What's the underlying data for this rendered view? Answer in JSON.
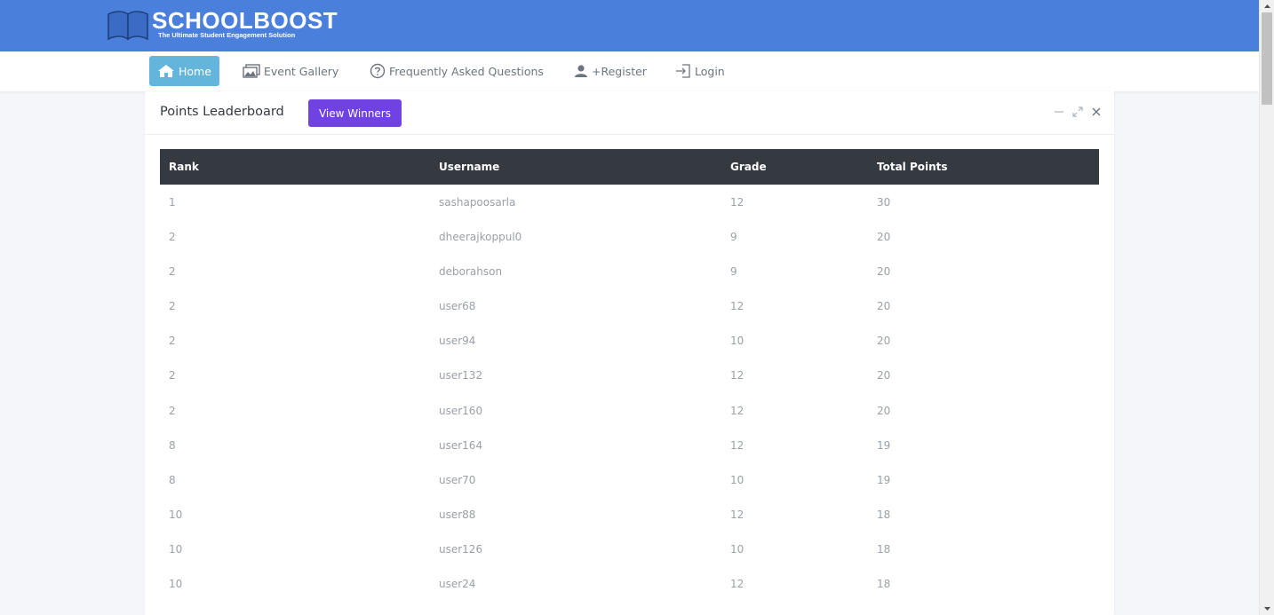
{
  "header": {
    "brand_title": "SCHOOLBOOST",
    "brand_tagline": "The Ultimate Student Engagement Solution",
    "background_color": "#4a7fdc"
  },
  "nav": {
    "items": [
      {
        "label": "Home",
        "icon": "home-icon",
        "active": true
      },
      {
        "label": "Event Gallery",
        "icon": "gallery-icon",
        "active": false
      },
      {
        "label": "Frequently Asked Questions",
        "icon": "question-circle-icon",
        "active": false
      },
      {
        "label": "+Register",
        "icon": "user-add-icon",
        "active": false
      },
      {
        "label": "Login",
        "icon": "sign-in-icon",
        "active": false
      }
    ],
    "active_color": "#64b5dc"
  },
  "card": {
    "title": "Points Leaderboard",
    "winners_button": "View Winners",
    "button_color": "#6f42e1",
    "tools": [
      "minimize-icon",
      "expand-icon",
      "close-icon"
    ]
  },
  "table": {
    "headers": [
      "Rank",
      "Username",
      "Grade",
      "Total Points"
    ],
    "rows": [
      {
        "rank": "1",
        "username": "sashapoosarla",
        "grade": "12",
        "points": "30"
      },
      {
        "rank": "2",
        "username": "dheerajkoppul0",
        "grade": "9",
        "points": "20"
      },
      {
        "rank": "2",
        "username": "deborahson",
        "grade": "9",
        "points": "20"
      },
      {
        "rank": "2",
        "username": "user68",
        "grade": "12",
        "points": "20"
      },
      {
        "rank": "2",
        "username": "user94",
        "grade": "10",
        "points": "20"
      },
      {
        "rank": "2",
        "username": "user132",
        "grade": "12",
        "points": "20"
      },
      {
        "rank": "2",
        "username": "user160",
        "grade": "12",
        "points": "20"
      },
      {
        "rank": "8",
        "username": "user164",
        "grade": "12",
        "points": "19"
      },
      {
        "rank": "8",
        "username": "user70",
        "grade": "10",
        "points": "19"
      },
      {
        "rank": "10",
        "username": "user88",
        "grade": "12",
        "points": "18"
      },
      {
        "rank": "10",
        "username": "user126",
        "grade": "10",
        "points": "18"
      },
      {
        "rank": "10",
        "username": "user24",
        "grade": "12",
        "points": "18"
      }
    ],
    "header_color": "#343a40"
  }
}
